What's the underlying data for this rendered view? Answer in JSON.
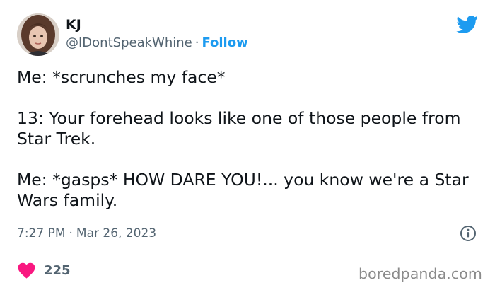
{
  "author": {
    "name": "KJ",
    "handle": "@IDontSpeakWhine",
    "separator": "·",
    "follow_label": "Follow"
  },
  "tweet": {
    "paragraphs": [
      "Me: *scrunches my face*",
      "13: Your forehead looks like one of those people from Star Trek.",
      "Me: *gasps* HOW DARE YOU!... you know we're a Star Wars family."
    ],
    "time": "7:27 PM",
    "separator": "·",
    "date": "Mar 26, 2023"
  },
  "engagement": {
    "likes": "225"
  },
  "watermark": "boredpanda.com",
  "icons": {
    "platform": "twitter-bird-icon",
    "info": "info-icon",
    "like": "heart-icon"
  },
  "colors": {
    "accent": "#1d9bf0",
    "heart": "#f91880",
    "secondary_text": "#536471",
    "primary_text": "#0f1419",
    "watermark": "#8a8a8a"
  }
}
